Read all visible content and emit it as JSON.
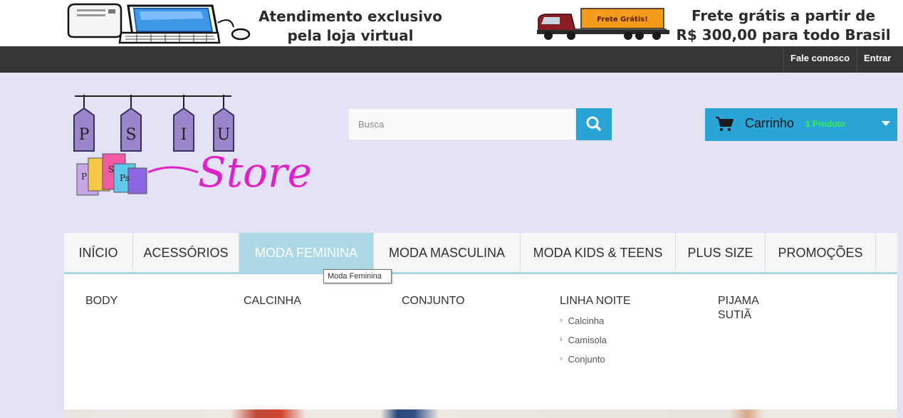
{
  "banner": {
    "left_line1": "Atendimento exclusivo",
    "left_line2": "pela loja virtual",
    "truck_sign": "Frete Grátis!",
    "right_line1": "Frete grátis a partir de",
    "right_line2": "R$ 300,00 para todo Brasil"
  },
  "topnav": {
    "contact": "Fale conosco",
    "login": "Entrar"
  },
  "logo": {
    "letters": [
      "P",
      "S",
      "I",
      "U"
    ],
    "script": "Store",
    "bag_marks": [
      "P",
      "S",
      "Ps"
    ]
  },
  "search": {
    "placeholder": "Busca"
  },
  "cart": {
    "label": "Carrinho",
    "count": "1 Produto"
  },
  "menu": {
    "items": [
      "INÍCIO",
      "ACESSÓRIOS",
      "MODA FEMININA",
      "MODA MASCULINA",
      "MODA KIDS & TEENS",
      "PLUS SIZE",
      "PROMOÇÕES"
    ],
    "active": "MODA FEMININA"
  },
  "tooltip": "Moda Feminina",
  "dropdown": {
    "col1": "BODY",
    "col2": "CALCINHA",
    "col3": "CONJUNTO",
    "col4": "LINHA NOITE",
    "col4_subs": [
      "Calcinha",
      "Camisola",
      "Conjunto"
    ],
    "col5a": "PIJAMA",
    "col5b": "SUTIÃ"
  },
  "colors": {
    "accent": "#2aa3d6",
    "active_menu": "#add8e6",
    "topnav": "#353535",
    "page_bg": "#e4e3f6",
    "cart_count": "#3cf04e",
    "logo_pink": "#e020c8",
    "logo_purple": "#9b86cc"
  },
  "icons": [
    "computer-icon",
    "truck-icon",
    "search-icon",
    "cart-icon",
    "caret-down-icon",
    "chevron-right-icon"
  ]
}
